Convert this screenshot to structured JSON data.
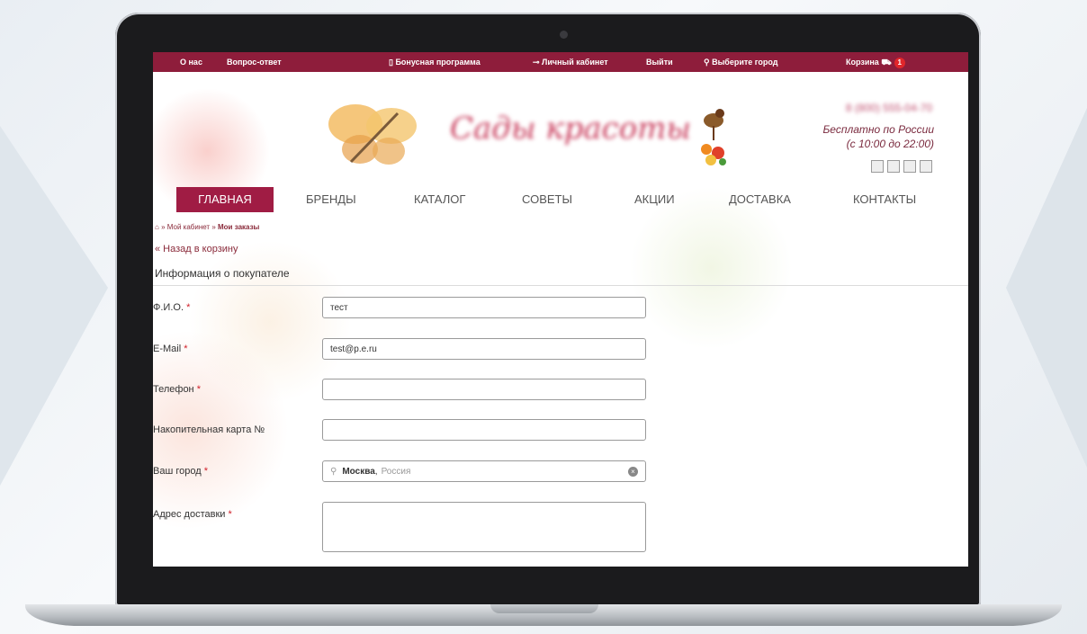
{
  "topbar": {
    "about": "О нас",
    "faq": "Вопрос-ответ",
    "bonus": "Бонусная программа",
    "account": "Личный кабинет",
    "logout": "Выйти",
    "city": "Выберите город",
    "cart": "Корзина",
    "cart_count": "1"
  },
  "header": {
    "logo_text": "Сады красоты",
    "phone": "8 (800) 555-04-70",
    "free_call_line1": "Бесплатно по России",
    "free_call_line2": "(с 10:00 до 22:00)"
  },
  "nav": {
    "home": "ГЛАВНАЯ",
    "brands": "БРЕНДЫ",
    "catalog": "КАТАЛОГ",
    "tips": "СОВЕТЫ",
    "promos": "АКЦИИ",
    "delivery": "ДОСТАВКА",
    "contacts": "КОНТАКТЫ"
  },
  "breadcrumb": {
    "account": "Мой кабинет",
    "orders": "Мои заказы"
  },
  "page": {
    "back_link": "« Назад в корзину",
    "section_title": "Информация о покупателе"
  },
  "form": {
    "fio_label": "Ф.И.О.",
    "fio_value": "тест",
    "email_label": "E-Mail",
    "email_value": "test@p.e.ru",
    "phone_label": "Телефон",
    "phone_value": "",
    "card_label": "Накопительная карта №",
    "card_value": "",
    "city_label": "Ваш город",
    "city_value": "Москва",
    "city_country": "Россия",
    "address_label": "Адрес доставки",
    "address_value": "",
    "required_mark": "*"
  },
  "colors": {
    "brand": "#8e1d3b",
    "nav_active": "#a01c44",
    "required": "#d0202a"
  }
}
